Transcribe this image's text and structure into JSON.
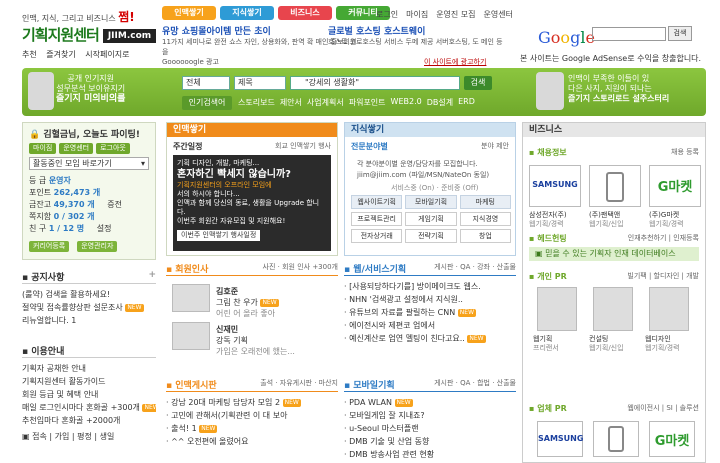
{
  "header": {
    "tagline": "인맥, 지식, 그리고 비즈니스",
    "tagline_em": "쩜!",
    "logo": "기획지원센터",
    "logo_badge": "JIIM.com",
    "links": [
      "추천",
      "즐겨찾기",
      "시작페이지로"
    ],
    "tabs": [
      {
        "label": "인맥쌓기",
        "color": "#f7a21b"
      },
      {
        "label": "지식쌓기",
        "color": "#2e9bd6"
      },
      {
        "label": "비즈니스",
        "color": "#e8454d"
      },
      {
        "label": "커뮤니티",
        "color": "#45a834"
      }
    ],
    "util": [
      "로그인",
      "마이짐",
      "운영진 모집",
      "운영센터"
    ]
  },
  "ads": [
    {
      "title": "유망 쇼핑몰아이템 만든 초이",
      "body": "11가지 세미나로 완전 쇼스 자인, 상용화와, 판역 확 매인 홍보회원을"
    },
    {
      "title": "글로벌 호스팅 호스트웨이",
      "body": "호스트 코로호스팅 서비스 두메 제공 서버호스팅, 도 메인 등"
    }
  ],
  "ad_footer": "Goooooogle 광고",
  "ad_footer2": "이 사이트에 광고하기",
  "google": {
    "letters": [
      "G",
      "o",
      "o",
      "g",
      "l",
      "e"
    ],
    "search_label": "검색",
    "note": "본 사이트는 Google AdSense로 수익을 창출합니다."
  },
  "bar": {
    "left1": "공개 인기지원",
    "left2": "설무분석 보이유지기",
    "left3": "즐기지 미의비의를",
    "right1": "인맥이 부족한 이들이 있",
    "right2": "다은 사지, 지원이 되나는",
    "right3": "즐기지 스토리로드 설주스터리",
    "select1": "전체",
    "select2": "제목",
    "search_value": "\"강세의 생활화\"",
    "search_btn": "검색",
    "kw_btn": "인기검색어",
    "keywords": [
      "스토리보드",
      "제안서",
      "사업계획서",
      "파워포인트",
      "WEB2.0",
      "DB설계",
      "ERD"
    ]
  },
  "login": {
    "welcome": "김혈금님, 오늘도 파이팅!",
    "btns": [
      "마이짐",
      "운영센터",
      "로그아웃"
    ],
    "community": "활동중인 모임 바로가기",
    "stats": [
      {
        "k": "등 급",
        "v": "운영자"
      },
      {
        "k": "포인트",
        "v": "262,473 개"
      },
      {
        "k": "금잔고",
        "v": "49,370 개"
      },
      {
        "k": "쪽지함",
        "v": "0 / 302 개"
      },
      {
        "k": "친 구",
        "v": "1 / 12 명"
      }
    ],
    "stat_note": [
      "증전",
      "설정"
    ],
    "btn_a": "커리어등록",
    "btn_b": "운영관리자"
  },
  "notice": {
    "title": "공지사항",
    "items": [
      "(룰약) 검색을 활용하세요!",
      "절약및 접속률향상판 설문조사",
      "리뉴얼합니다. 1"
    ]
  },
  "guide": {
    "title": "이용안내",
    "items": [
      "기획자 공채한 안내",
      "기획지원센터 활동가이드",
      "회원 등급 및 혜택 안내",
      "매일 로그인시마다 혼화골 +300개",
      "추천입마다 혼화골 +2000개"
    ],
    "footer": [
      "접속",
      "가입",
      "평정",
      "생일"
    ]
  },
  "inmaek": {
    "title": "인맥쌓기",
    "sub": "주간일정",
    "sub_right": "회교 인맥쌓기 행사",
    "banner": [
      "기획 디자인, 개발, 마케팅...",
      "혼자하긴 빡세지 않습니까?",
      "기획지원센터의 오프라인 모임에",
      "서의 하시야 합니다...",
      "인맥과 함께 당신의 동료, 생활을 Upgrade 합니다.",
      "이번주 회원간 자유모집 및 지원해요!"
    ],
    "banner_btn": "이번주 인맥쌓기 행사일정"
  },
  "member": {
    "title": "회원인사",
    "sub": "사진",
    "sub2": "회원 인사 +300개",
    "items": [
      {
        "name": "김호준",
        "text": "그림 찬 우가",
        "sub": "어린 어 올라 좋아"
      },
      {
        "name": "신재민",
        "text": "강독 기획",
        "sub": "가입은 오래전에 했는..."
      }
    ]
  },
  "inboard": {
    "title": "인맥게시판",
    "sub": [
      "출석",
      "자유게시판",
      "마산지"
    ],
    "items": [
      "강남 20대 마케팅 담당자 모임 2",
      "고민에 관해서(기획관련 이 대 보아",
      "출석! 1",
      "^^ 오전편에 올렸어요"
    ]
  },
  "jisik": {
    "title": "지식쌓기",
    "sub": "전문분야별",
    "sub_right": "분야 제안",
    "notice": "각 분야분이별 운영/담당자를 모집합니다.",
    "contact": "jiim@jiim.com (파일/MSN/NateOn 동일)",
    "status_label": "서비스중 (On)",
    "status_label2": "준비중 (Off)",
    "cats": [
      "웹사이트기획",
      "모바일기획",
      "마케팅",
      "프로젝트관리",
      "게임기획",
      "지식경영",
      "전자상거래",
      "전략기획",
      "창업"
    ]
  },
  "webplan": {
    "title": "웹/서비스기획",
    "sub": [
      "게시판",
      "QA",
      "강좌",
      "산출물"
    ],
    "items": [
      "[사용되당하다기를] 방이메이크도 웹스.",
      "NHN '검색광고 설정에서 지식원..",
      "유튜브의 자료를 팔릴하는 CNN",
      "에이전시와 제편코 업에서",
      "예신계산로 업연 멜팅이 친다고요.."
    ]
  },
  "mobile": {
    "title": "모바일기획",
    "sub": [
      "게시판",
      "QA",
      "합법",
      "산출물"
    ],
    "items": [
      "PDA WLAN",
      "모바일게임 잘 지내죠?",
      "u-Seoul 마스터플랜",
      "DMB 기술 및 산업 동향",
      "DMB 방송사업 관련 현황"
    ]
  },
  "biz": {
    "title": "비즈니스",
    "employ": "채용정보",
    "employ_right": "채용 등록",
    "companies": [
      {
        "logo": "SAMSUNG",
        "name": "삼성전자(주)",
        "sub": "웹기획/경력"
      },
      {
        "logo": "phone",
        "name": "(주)팬택앤",
        "sub": "웹기획/신입"
      },
      {
        "logo": "G마켓",
        "name": "(주)G마켓",
        "sub": "웹기획/경력"
      }
    ],
    "headhunt": "헤드헌팅",
    "headhunt_right": "인재추천하기 | 인재등록",
    "headhunt_text": "믿을 수 있는 기획자 인재 데이터베이스",
    "pr": "개인 PR",
    "pr_right": "빌기팩 | 할디자인 | 개발",
    "people": [
      {
        "name": "웹기획",
        "sub": "프리랜서"
      },
      {
        "name": "컨설팅",
        "sub": "웹기획/신입"
      },
      {
        "name": "웹디자인",
        "sub": "웹기획/경력"
      }
    ],
    "upr": "업체 PR",
    "upr_right": "웹에이전시 | SI | 솔루션"
  },
  "colors": {
    "accent_green": "#6fa82b",
    "dark_green": "#3c7a1c",
    "orange": "#f08b1b",
    "blue": "#2e7bc4"
  }
}
